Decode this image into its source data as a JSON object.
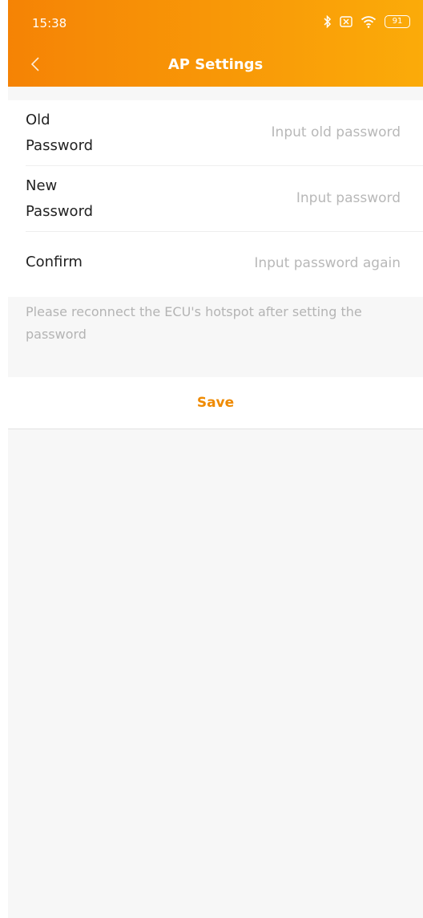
{
  "status_bar": {
    "time": "15:38",
    "battery": "91"
  },
  "nav": {
    "title": "AP Settings",
    "back_icon": "chevron-left-icon"
  },
  "form": {
    "fields": [
      {
        "label_line1": "Old",
        "label_line2": "Password",
        "placeholder": "Input old password",
        "value": ""
      },
      {
        "label_line1": "New",
        "label_line2": "Password",
        "placeholder": "Input password",
        "value": ""
      },
      {
        "label": "Confirm",
        "placeholder": "Input password again",
        "value": ""
      }
    ]
  },
  "notice": "Please reconnect the ECU's hotspot after setting the password",
  "save_label": "Save",
  "colors": {
    "header_start": "#f58305",
    "header_end": "#fbab09",
    "accent": "#ef8a00"
  }
}
